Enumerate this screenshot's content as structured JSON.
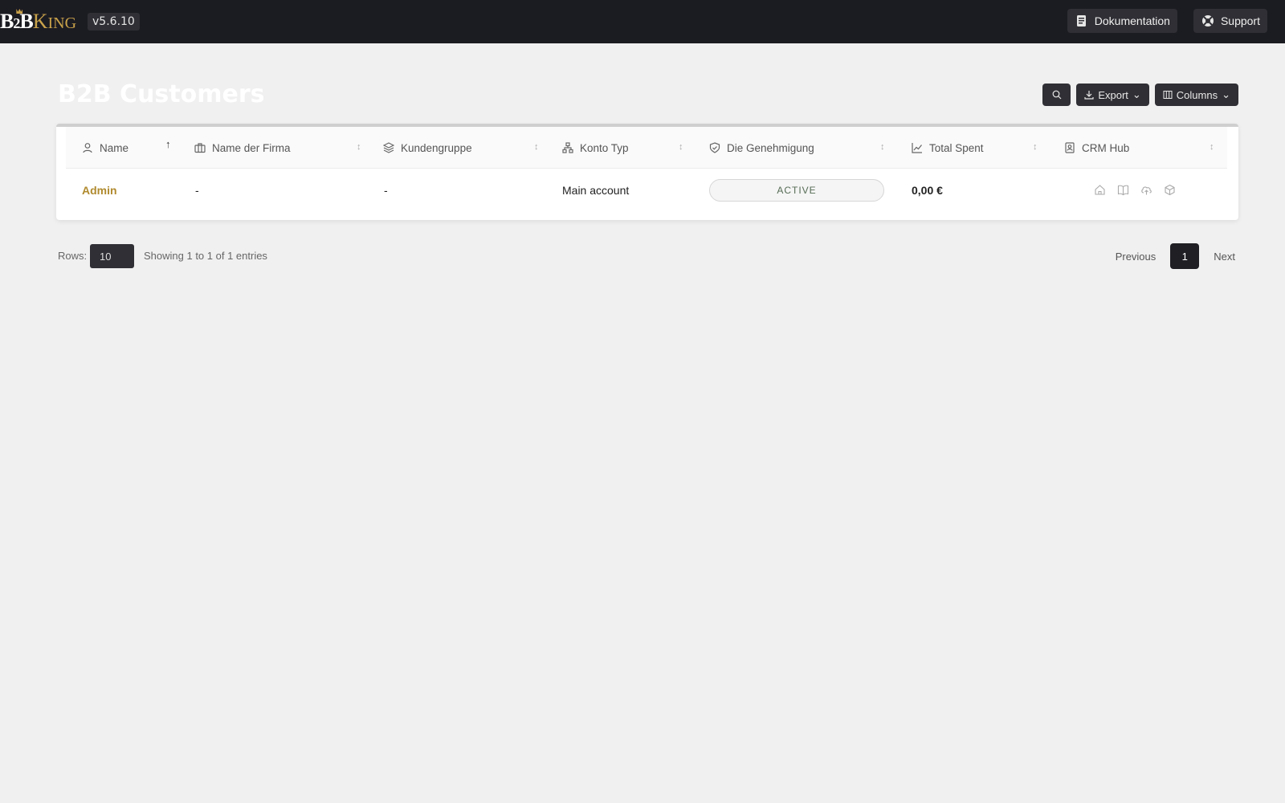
{
  "topbar": {
    "logo_b": "B",
    "logo_2": "2",
    "logo_b2": "B",
    "logo_k": "K",
    "logo_ing": "ING",
    "version": "v5.6.10",
    "docs_label": "Dokumentation",
    "support_label": "Support"
  },
  "page": {
    "title": "B2B Customers",
    "export_label": "Export",
    "columns_label": "Columns"
  },
  "table": {
    "headers": {
      "name": "Name",
      "company": "Name der Firma",
      "group": "Kundengruppe",
      "account_type": "Konto Typ",
      "approval": "Die Genehmigung",
      "total_spent": "Total Spent",
      "crm_hub": "CRM Hub"
    },
    "rows": [
      {
        "name": "Admin",
        "company": "-",
        "group": "-",
        "account_type": "Main account",
        "approval": "ACTIVE",
        "total_spent": "0,00 €"
      }
    ],
    "sort_indicator": "↑",
    "sort_neutral": "↕"
  },
  "footer": {
    "rows_label": "Rows:",
    "rows_value": "10",
    "showing": "Showing 1 to 1 of 1 entries",
    "previous": "Previous",
    "page": "1",
    "next": "Next"
  },
  "colors": {
    "topbar": "#1b1b22",
    "accent_gold": "#b08a2e",
    "background": "#f0f0f0"
  },
  "icons": [
    "docs-icon",
    "support-icon",
    "search-icon",
    "download-icon",
    "columns-icon",
    "user-icon",
    "briefcase-icon",
    "layers-icon",
    "sitemap-icon",
    "shield-icon",
    "chart-icon",
    "contact-icon",
    "home-icon",
    "book-icon",
    "upload-icon",
    "box-icon"
  ]
}
